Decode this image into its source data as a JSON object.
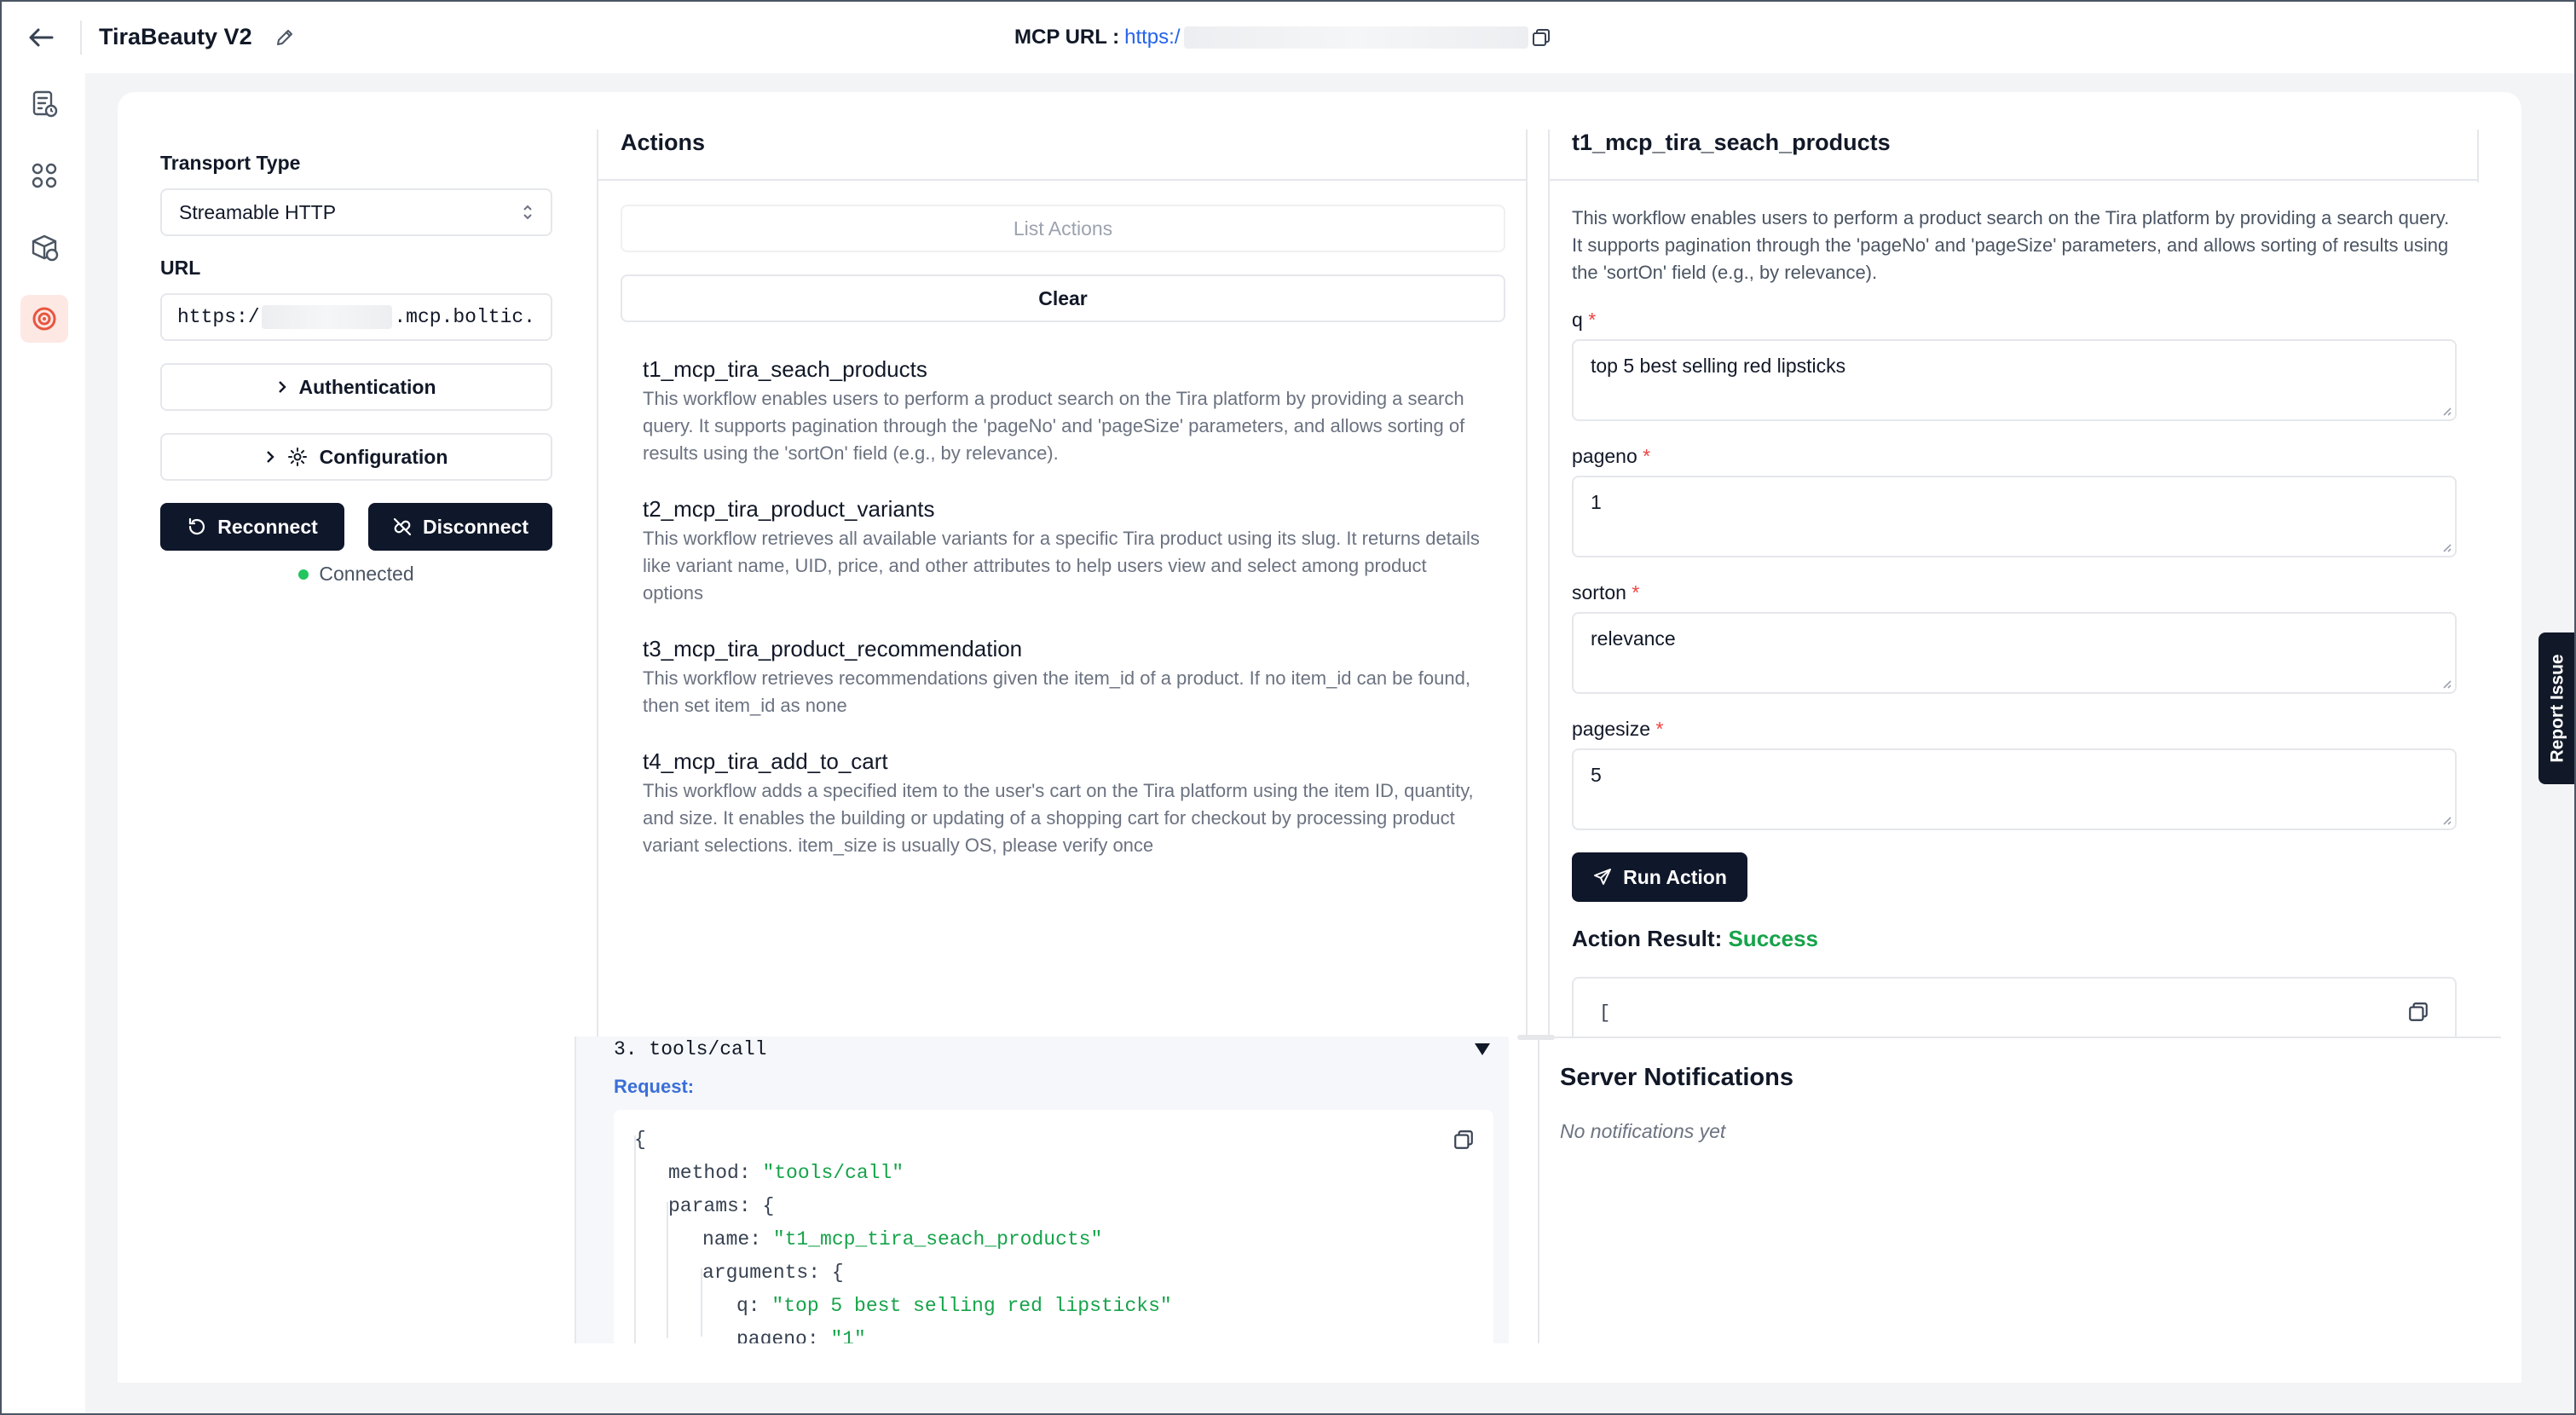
{
  "header": {
    "title": "TiraBeauty V2",
    "mcp_url_label": "MCP URL :",
    "mcp_url_prefix": "https:/",
    "mcp_url_suffix": "..."
  },
  "config": {
    "transport_label": "Transport Type",
    "transport_value": "Streamable HTTP",
    "url_label": "URL",
    "url_prefix": "https:/",
    "url_suffix": ".mcp.boltic.",
    "authentication_label": "Authentication",
    "configuration_label": "Configuration",
    "reconnect_label": "Reconnect",
    "disconnect_label": "Disconnect",
    "status_text": "Connected",
    "status_color": "#22c55e"
  },
  "actions": {
    "title": "Actions",
    "list_button": "List Actions",
    "clear_button": "Clear",
    "items": [
      {
        "name": "t1_mcp_tira_seach_products",
        "description": "This workflow enables users to perform a product search on the Tira platform by providing a search query. It supports pagination through the 'pageNo' and 'pageSize' parameters, and allows sorting of results using the 'sortOn' field (e.g., by relevance)."
      },
      {
        "name": "t2_mcp_tira_product_variants",
        "description": "This workflow retrieves all available variants for a specific Tira product using its slug. It returns details like variant name, UID, price, and other attributes to help users view and select among product options"
      },
      {
        "name": "t3_mcp_tira_product_recommendation",
        "description": "This workflow retrieves recommendations given the item_id of a product. If no item_id can be found, then set item_id as none"
      },
      {
        "name": "t4_mcp_tira_add_to_cart",
        "description": "This workflow adds a specified item to the user's cart on the Tira platform using the item ID, quantity, and size. It enables the building or updating of a shopping cart for checkout by processing product variant selections. item_size is usually OS, please verify once"
      }
    ]
  },
  "tool": {
    "title": "t1_mcp_tira_seach_products",
    "description": "This workflow enables users to perform a product search on the Tira platform by providing a search query. It supports pagination through the 'pageNo' and 'pageSize' parameters, and allows sorting of results using the 'sortOn' field (e.g., by relevance).",
    "fields": [
      {
        "label": "q",
        "value": "top 5 best selling red lipsticks"
      },
      {
        "label": "pageno",
        "value": "1"
      },
      {
        "label": "sorton",
        "value": "relevance"
      },
      {
        "label": "pagesize",
        "value": "5"
      }
    ],
    "required_marker": "*",
    "run_button": "Run Action",
    "result_label": "Action Result:",
    "result_status": "Success",
    "result_preview": "["
  },
  "history": {
    "entry_title": "3. tools/call",
    "request_label": "Request:",
    "code": {
      "open": "{",
      "method_key": "method:",
      "method_val": "\"tools/call\"",
      "params_key": "params:",
      "params_open": "{",
      "name_key": "name:",
      "name_val": "\"t1_mcp_tira_seach_products\"",
      "arguments_key": "arguments:",
      "arguments_open": "{",
      "q_key": "q:",
      "q_val": "\"top 5 best selling red lipsticks\"",
      "pageno_key": "pageno:",
      "pageno_val": "\"1\""
    }
  },
  "notifications": {
    "title": "Server Notifications",
    "empty_text": "No notifications yet"
  },
  "report_issue_label": "Report Issue",
  "colors": {
    "accent_dark": "#0f172a",
    "success": "#16a34a",
    "link": "#2563eb",
    "brand_rail_active": "#e8563f"
  }
}
